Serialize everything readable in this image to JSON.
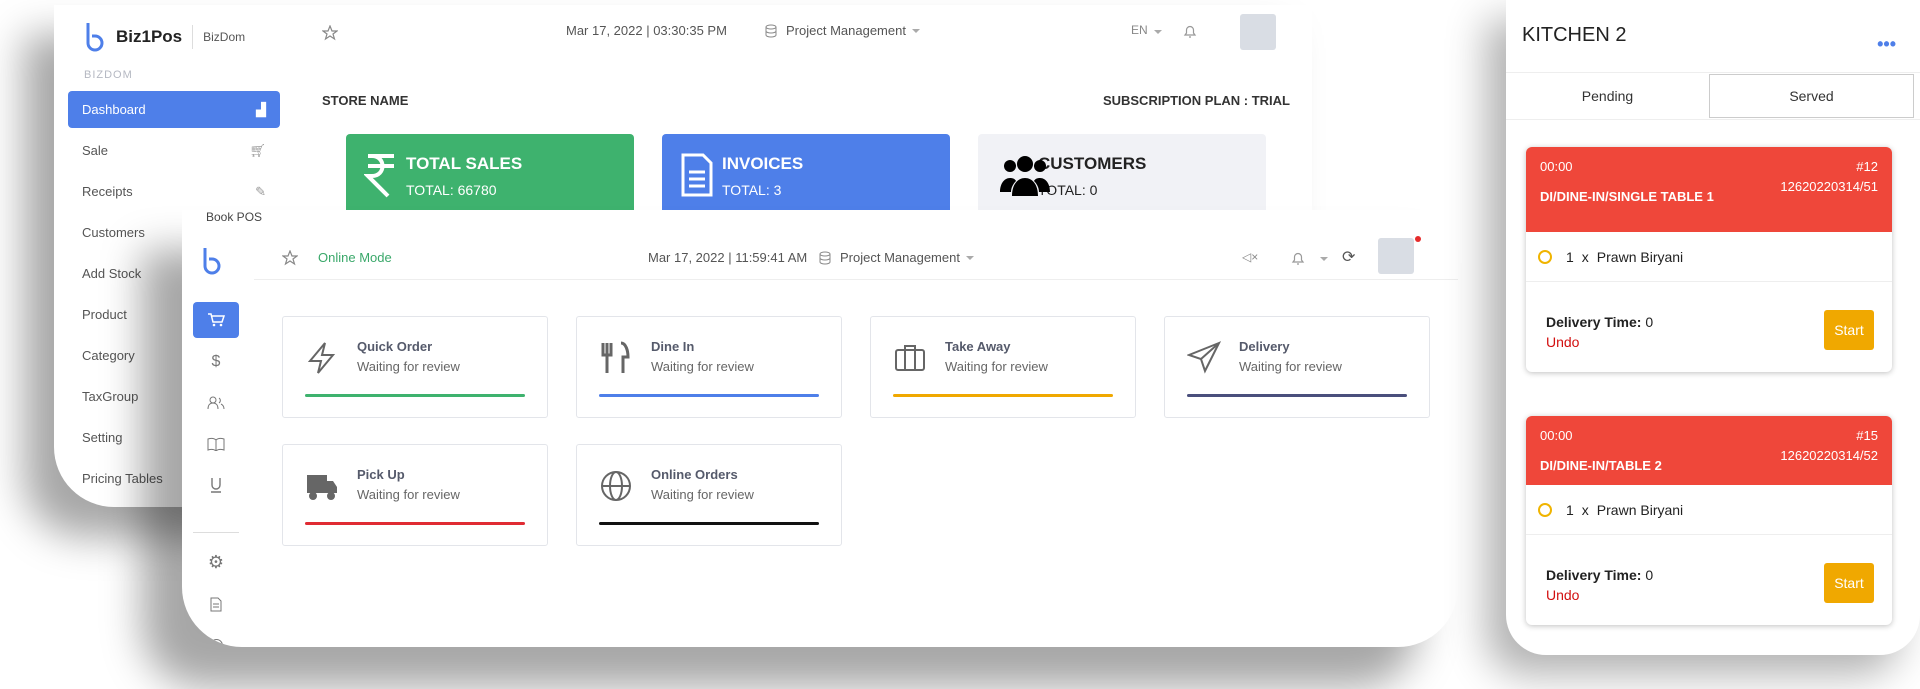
{
  "back": {
    "brand": "Biz1Pos",
    "brand_sub": "BizDom",
    "date": "Mar 17, 2022 | 03:30:35 PM",
    "project": "Project Management",
    "lang": "EN",
    "sidebar_header": "BIZDOM",
    "sidebar": [
      "Dashboard",
      "Sale",
      "Receipts",
      "Customers",
      "Add Stock",
      "Product",
      "Category",
      "TaxGroup",
      "Setting",
      "Pricing Tables"
    ],
    "store_name": "STORE NAME",
    "plan": "SUBSCRIPTION PLAN : TRIAL",
    "stats": [
      {
        "title": "TOTAL SALES",
        "value": "TOTAL: 66780",
        "color": "#3eb26e"
      },
      {
        "title": "INVOICES",
        "value": "TOTAL: 3",
        "color": "#4e7fe9"
      },
      {
        "title": "CUSTOMERS",
        "value": "TOTAL: 0",
        "color": "#f1f2f6"
      }
    ]
  },
  "front": {
    "window_label": "Book POS",
    "mode": "Online Mode",
    "date": "Mar 17, 2022 | 11:59:41 AM",
    "project": "Project Management",
    "cards": [
      {
        "title": "Quick Order",
        "sub": "Waiting for review",
        "icon": "lightning-icon",
        "color": "#3eb26e"
      },
      {
        "title": "Dine In",
        "sub": "Waiting for review",
        "icon": "utensils-icon",
        "color": "#4e7fe9"
      },
      {
        "title": "Take Away",
        "sub": "Waiting for review",
        "icon": "briefcase-icon",
        "color": "#f0a800"
      },
      {
        "title": "Delivery",
        "sub": "Waiting for review",
        "icon": "paper-plane-icon",
        "color": "#4a4f7c"
      },
      {
        "title": "Pick Up",
        "sub": "Waiting for review",
        "icon": "truck-icon",
        "color": "#e02b33"
      },
      {
        "title": "Online Orders",
        "sub": "Waiting for review",
        "icon": "globe-icon",
        "color": "#111111"
      }
    ]
  },
  "kitchen": {
    "title": "KITCHEN 2",
    "tabs": [
      "Pending",
      "Served"
    ],
    "orders": [
      {
        "time": "00:00",
        "no": "#12",
        "inv": "12620220314/51",
        "table": "DI/DINE-IN/SINGLE TABLE 1",
        "qty": "1",
        "x": "x",
        "item": "Prawn Biryani",
        "delivery_label": "Delivery Time:",
        "delivery": "0",
        "undo": "Undo",
        "start": "Start"
      },
      {
        "time": "00:00",
        "no": "#15",
        "inv": "12620220314/52",
        "table": "DI/DINE-IN/TABLE 2",
        "qty": "1",
        "x": "x",
        "item": "Prawn Biryani",
        "delivery_label": "Delivery Time:",
        "delivery": "0",
        "undo": "Undo",
        "start": "Start"
      }
    ]
  }
}
